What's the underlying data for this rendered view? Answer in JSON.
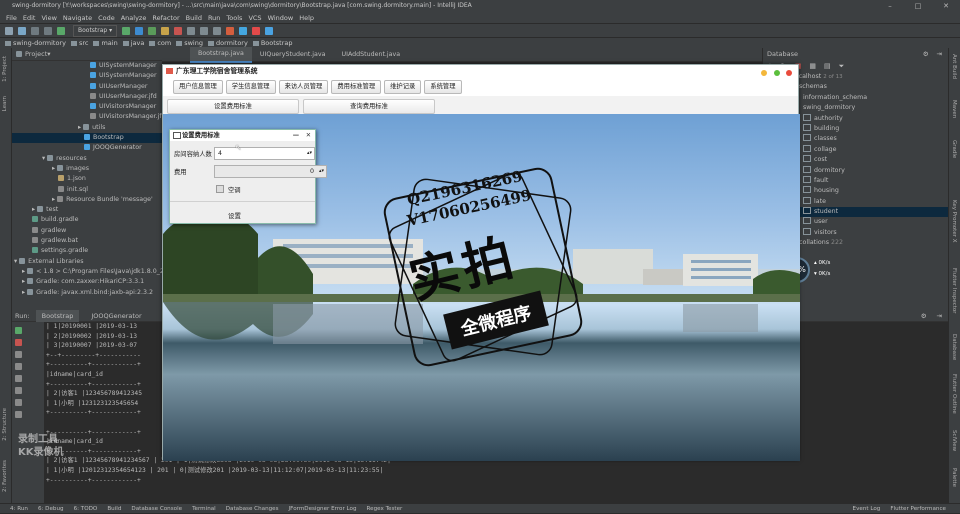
{
  "ide": {
    "title": "swing-dormitory [Y:\\workspaces\\swing\\swing-dormitory] - ...\\src\\main\\java\\com\\swing\\dormitory\\Bootstrap.java [com.swing.dormitory.main] - IntelliJ IDEA",
    "menu": [
      "File",
      "Edit",
      "View",
      "Navigate",
      "Code",
      "Analyze",
      "Refactor",
      "Build",
      "Run",
      "Tools",
      "VCS",
      "Window",
      "Help"
    ],
    "run_config": "Bootstrap",
    "breadcrumbs": [
      "swing-dormitory",
      "src",
      "main",
      "java",
      "com",
      "swing",
      "dormitory",
      "Bootstrap"
    ],
    "left_tabs": [
      "1: Project",
      "Learn",
      "2: Structure",
      "2: Favorites"
    ],
    "right_tabs": [
      "Ant Build",
      "Maven",
      "Gradle",
      "Key Promoter X",
      "Flutter Inspector",
      "Database",
      "Flutter Outline",
      "SciView",
      "Palette"
    ]
  },
  "project": {
    "header": "Project",
    "items": [
      "UISystemManager",
      "UISystemManager",
      "UIUserManager",
      "UIUserManager.jfd",
      "UIVisitorsManager",
      "UIVisitorsManager.jfd",
      "utils",
      "Bootstrap",
      "JOOQGenerator",
      "resources",
      "images",
      "1.json",
      "init.sql",
      "Resource Bundle 'message'",
      "test",
      "build.gradle",
      "gradlew",
      "gradlew.bat",
      "settings.gradle",
      "External Libraries",
      "< 1.8 > C:\\Program Files\\Java\\jdk1.8.0_20",
      "Gradle: com.zaxxer:HikariCP:3.3.1",
      "Gradle: javax.xml.bind:jaxb-api:2.3.2"
    ]
  },
  "editor_tabs": [
    "Bootstrap.java",
    "UIQueryStudent.java",
    "UIAddStudent.java"
  ],
  "database": {
    "header": "Database",
    "host": "localhost",
    "host_meta": "2 of 13",
    "items": [
      "schemas",
      "information_schema",
      "swing_dormitory",
      "authority",
      "building",
      "classes",
      "collage",
      "cost",
      "dormitory",
      "fault",
      "housing",
      "late",
      "student",
      "user",
      "visitors",
      "collations"
    ],
    "collations_count": "222",
    "selected": "student"
  },
  "run": {
    "label": "Run:",
    "tabs": [
      "Bootstrap",
      "JOOQGenerator"
    ],
    "lines": [
      "| 1|20190001 |2019-03-13",
      "| 2|20190002 |2019-03-13",
      "| 3|20190007 |2019-03-07",
      "+--+---------+-----------",
      "+----------+------------+",
      "|idname|card_id",
      "+----------+------------+",
      "| 2|访客1 |123456789412345",
      "| 1|小明 |123123123545654",
      "+----------+------------+",
      "",
      "+----------+------------+",
      "|idname|card_id",
      "+----------+------------+",
      "| 2|访客1 |12345678941234567 | 201 | 1|测试修改3303 |2019-03-08|23:09:50|2019-03-13|15:11:42|",
      "| 1|小明 |12012312354654123 | 201 | 0|测试修改201 |2019-03-13|11:12:07|2019-03-13|11:23:55|",
      "+----------+------------+"
    ]
  },
  "status": [
    "4: Run",
    "6: Debug",
    "6: TODO",
    "Build",
    "Database Console",
    "Terminal",
    "Database Changes",
    "JFormDesigner Error Log",
    "Regex Tester",
    "Event Log",
    "Flutter Performance"
  ],
  "app": {
    "title": "广东理工学院宿舍管理系统",
    "menu": [
      "用户信息管理",
      "学生信息管理",
      "来访人员管理",
      "费用标准管理",
      "维护记录",
      "系统管理"
    ],
    "tabs": [
      "设置费用标准",
      "查询费用标准"
    ]
  },
  "dialog": {
    "title": "设置费用标准",
    "label_count": "房间容纳人数",
    "count_value": "4",
    "label_cost": "费用",
    "cost_value": "0",
    "checkbox_label": "空调",
    "submit": "设置"
  },
  "watermark": {
    "qq": "Q2196316269",
    "wechat": "V17060256499",
    "big": "实拍",
    "sub": "全微程序",
    "recorder_line1": "录制工具",
    "recorder_line2": "KK录像机"
  },
  "cpu_widget": {
    "percent": "88%",
    "up": "0K/s",
    "down": "0K/s"
  },
  "colors": {
    "ide_bg": "#2b2b2b",
    "panel": "#3c3f41",
    "accent": "#4a88c7",
    "selected": "#0d293e",
    "app_bg": "#eeeeee"
  }
}
